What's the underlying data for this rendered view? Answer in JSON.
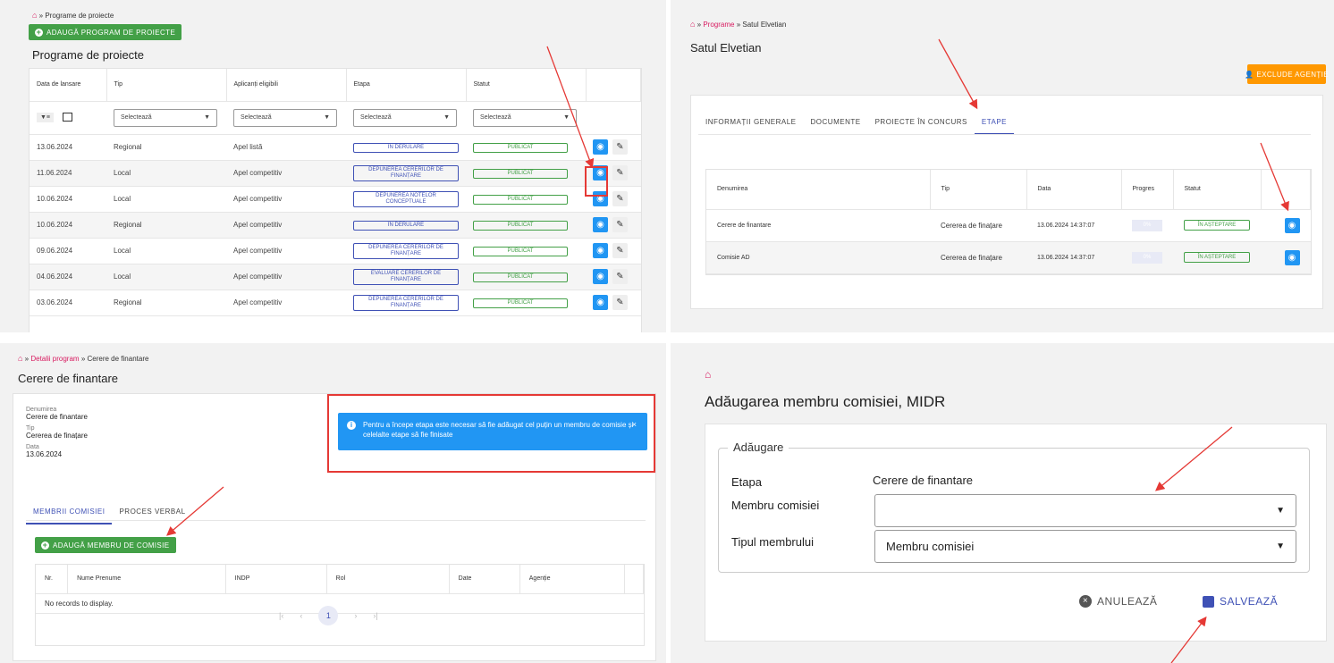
{
  "p1": {
    "breadcrumb": "» Programe de proiecte",
    "add_button": "ADAUGĂ PROGRAM DE PROIECTE",
    "title": "Programe de proiecte",
    "columns": [
      "Data de lansare",
      "Tip",
      "Aplicanți eligibili",
      "Etapa",
      "Statut"
    ],
    "filter_placeholder": "Selectează",
    "rows": [
      {
        "date": "13.06.2024",
        "type": "Regional",
        "applicants": "Apel listă",
        "stage": "ÎN DERULARE",
        "status": "PUBLICAT"
      },
      {
        "date": "11.06.2024",
        "type": "Local",
        "applicants": "Apel competitiv",
        "stage": "DEPUNEREA CERERILOR DE FINANȚARE",
        "status": "PUBLICAT"
      },
      {
        "date": "10.06.2024",
        "type": "Local",
        "applicants": "Apel competitiv",
        "stage": "DEPUNEREA NOTELOR CONCEPTUALE",
        "status": "PUBLICAT"
      },
      {
        "date": "10.06.2024",
        "type": "Regional",
        "applicants": "Apel competitiv",
        "stage": "ÎN DERULARE",
        "status": "PUBLICAT"
      },
      {
        "date": "09.06.2024",
        "type": "Local",
        "applicants": "Apel competitiv",
        "stage": "DEPUNEREA CERERILOR DE FINANȚARE",
        "status": "PUBLICAT"
      },
      {
        "date": "04.06.2024",
        "type": "Local",
        "applicants": "Apel competitiv",
        "stage": "EVALUARE CERERILOR DE FINANȚARE",
        "status": "PUBLICAT"
      },
      {
        "date": "03.06.2024",
        "type": "Regional",
        "applicants": "Apel competitiv",
        "stage": "DEPUNEREA CERERILOR DE FINANȚARE",
        "status": "PUBLICAT"
      }
    ]
  },
  "p2": {
    "breadcrumb_link": "Programe",
    "breadcrumb_current": "Satul Elvetian",
    "title": "Satul Elvetian",
    "exclude_button": "EXCLUDE AGENȚIE",
    "tabs": [
      "INFORMAȚII GENERALE",
      "DOCUMENTE",
      "PROIECTE ÎN CONCURS",
      "ETAPE"
    ],
    "columns": [
      "Denumirea",
      "Tip",
      "Data",
      "Progres",
      "Statut"
    ],
    "rows": [
      {
        "name": "Cerere de finantare",
        "type": "Cererea de finațare",
        "date": "13.06.2024 14:37:07",
        "progress": "0%",
        "status": "ÎN AȘTEPTARE"
      },
      {
        "name": "Comisie AD",
        "type": "Cererea de finațare",
        "date": "13.06.2024 14:37:07",
        "progress": "0%",
        "status": "ÎN AȘTEPTARE"
      }
    ]
  },
  "p3": {
    "breadcrumb_link": "Detalii program",
    "breadcrumb_current": "Cerere de finantare",
    "title": "Cerere de finantare",
    "fields": [
      {
        "label": "Denumirea",
        "value": "Cerere de finantare"
      },
      {
        "label": "Tip",
        "value": "Cererea de finațare"
      },
      {
        "label": "Data",
        "value": "13.06.2024"
      }
    ],
    "alert": "Pentru a începe etapa este necesar să fie adăugat cel puțin un membru de comisie și celelalte etape să fie finisate",
    "tabs": [
      "MEMBRII COMISIEI",
      "PROCES VERBAL"
    ],
    "add_button": "ADAUGĂ MEMBRU DE COMISIE",
    "columns": [
      "Nr.",
      "Nume Prenume",
      "INDP",
      "Rol",
      "Date",
      "Agenție"
    ],
    "empty": "No records to display.",
    "page": "1"
  },
  "p4": {
    "title": "Adăugarea membru comisiei, MIDR",
    "legend": "Adăugare",
    "etapa_label": "Etapa",
    "etapa_value": "Cerere de finantare",
    "member_label": "Membru comisiei",
    "member_value": "",
    "type_label": "Tipul membrului",
    "type_value": "Membru comisiei",
    "cancel": "ANULEAZĂ",
    "save": "SALVEAZĂ"
  },
  "colors": {
    "accent": "#3f51b5",
    "green": "#43a047",
    "blue": "#2196f3",
    "orange": "#ff9800",
    "red": "#e53935",
    "home": "#d81b60"
  }
}
